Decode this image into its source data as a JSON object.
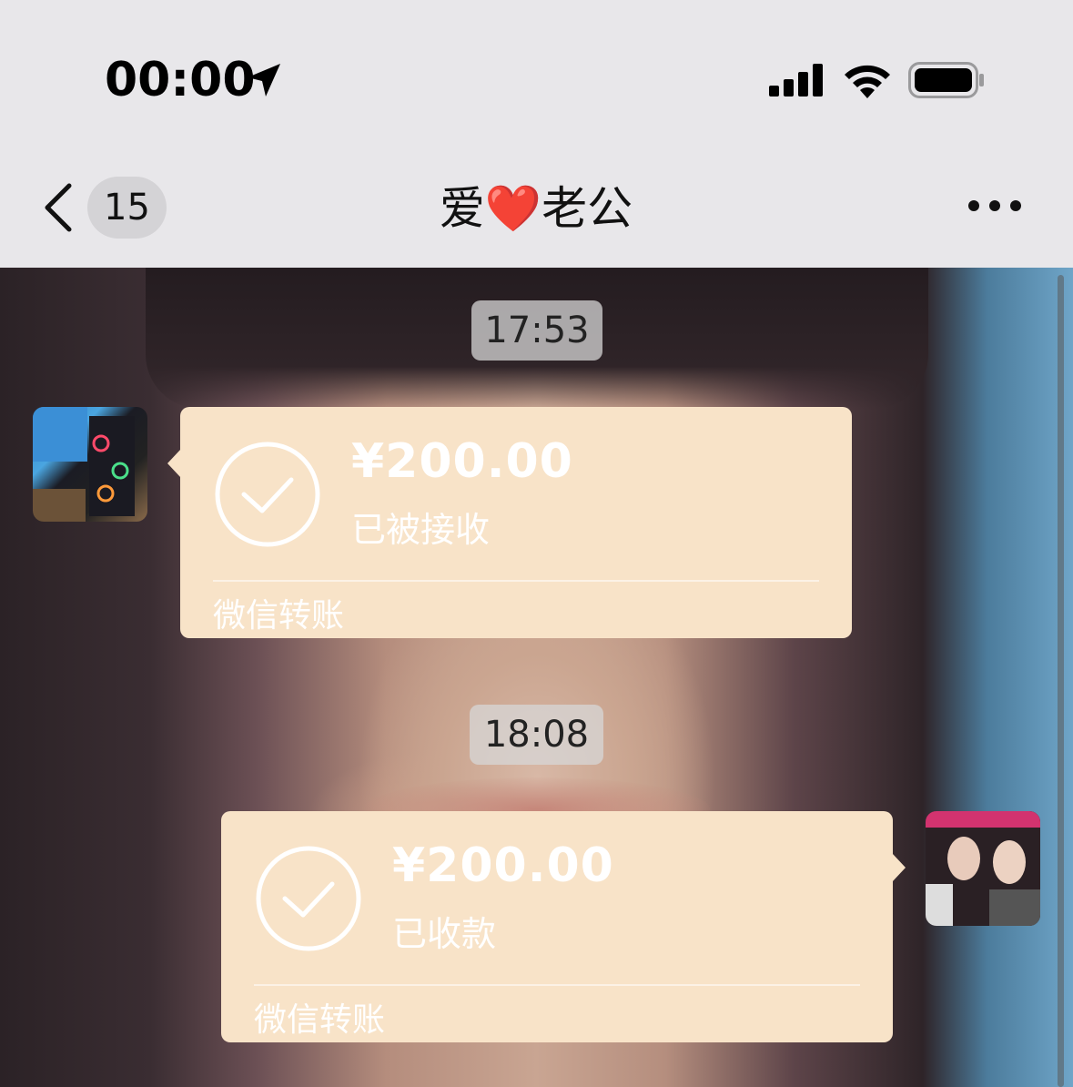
{
  "status_bar": {
    "time": "00:00",
    "icons": [
      "location-arrow-icon",
      "cellular-signal-icon",
      "wifi-icon",
      "battery-icon"
    ]
  },
  "nav": {
    "back_icon": "chevron-left-icon",
    "unread_count": "15",
    "title": "爱❤️老公",
    "more_icon": "more-dots-icon"
  },
  "chat": {
    "messages": [
      {
        "timestamp": "17:53",
        "side": "left",
        "type": "transfer",
        "amount": "¥200.00",
        "status": "已被接收",
        "footer": "微信转账"
      },
      {
        "timestamp": "18:08",
        "side": "right",
        "type": "transfer",
        "amount": "¥200.00",
        "status": "已收款",
        "footer": "微信转账"
      }
    ]
  },
  "colors": {
    "bubble": "#f8e3c8",
    "bubble_text": "#ffffff",
    "topbar": "#e8e7ea"
  }
}
